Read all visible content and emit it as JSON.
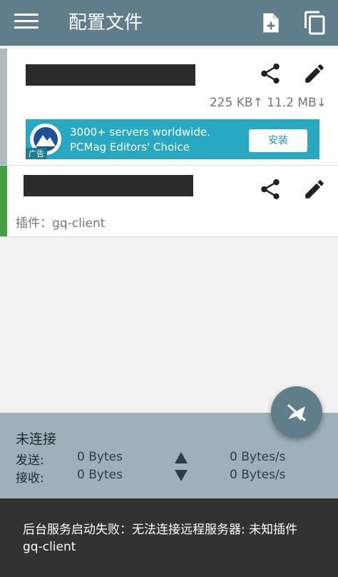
{
  "appbar": {
    "title": "配置文件",
    "icons": {
      "menu": "menu-icon",
      "new_file": "file-plus-icon",
      "copy": "copy-icon"
    }
  },
  "profiles": [
    {
      "name_redacted": true,
      "traffic": "225 KB↑ 11.2 MB↓",
      "status_color": "#aebcc2"
    },
    {
      "name_redacted": true,
      "plugin_label": "插件：gq-client",
      "status_color": "#43a047"
    }
  ],
  "ad": {
    "text": "3000+ servers worldwide. PCMag Editors' Choice",
    "tag": "广告",
    "install_label": "安装"
  },
  "stats": {
    "status": "未连接",
    "sent_label": "发送:",
    "sent_bytes": "0 Bytes",
    "sent_rate": "0 Bytes/s",
    "recv_label": "接收:",
    "recv_bytes": "0 Bytes",
    "recv_rate": "0 Bytes/s"
  },
  "snackbar": {
    "message": "后台服务启动失败：无法连接远程服务器: 未知插件 gq-client"
  },
  "colors": {
    "primary": "#607d8b",
    "stats_bg": "#9eb0b8",
    "snackbar_bg": "#323232",
    "ad_bg": "#27a9c2"
  }
}
